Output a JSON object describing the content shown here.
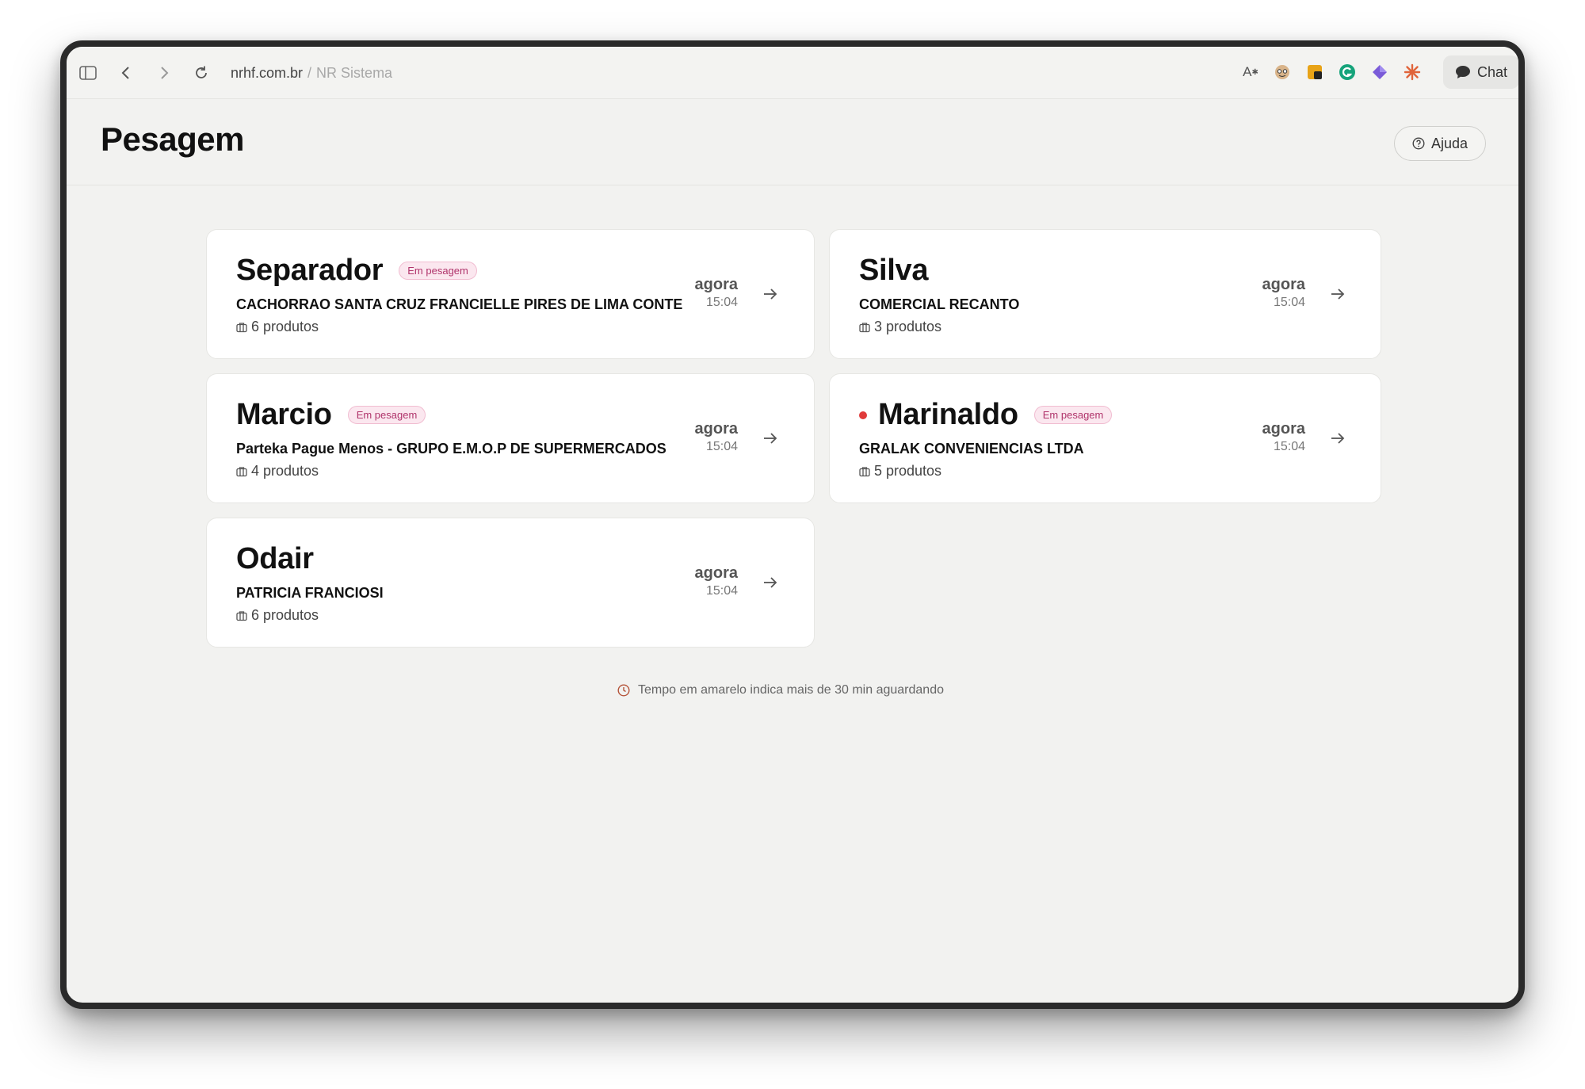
{
  "browser": {
    "url_domain": "nrhf.com.br",
    "url_separator": "/",
    "url_path": "NR Sistema",
    "chat_label": "Chat",
    "extensions": [
      "translate-icon",
      "extension-face-icon",
      "dictionary-icon",
      "grammarly-icon",
      "gem-icon",
      "sparkle-icon"
    ]
  },
  "header": {
    "title": "Pesagem",
    "help_label": "Ajuda"
  },
  "cards": [
    {
      "name": "Separador",
      "badge": "Em pesagem",
      "client": "CACHORRAO SANTA CRUZ FRANCIELLE PIRES DE LIMA CONTE",
      "products": "6 produtos",
      "time_rel": "agora",
      "time_abs": "15:04",
      "alert_dot": false
    },
    {
      "name": "Silva",
      "badge": "",
      "client": "COMERCIAL RECANTO",
      "products": "3 produtos",
      "time_rel": "agora",
      "time_abs": "15:04",
      "alert_dot": false
    },
    {
      "name": "Marcio",
      "badge": "Em pesagem",
      "client": "Parteka Pague Menos - GRUPO E.M.O.P DE SUPERMERCADOS",
      "products": "4 produtos",
      "time_rel": "agora",
      "time_abs": "15:04",
      "alert_dot": false
    },
    {
      "name": "Marinaldo",
      "badge": "Em pesagem",
      "client": "GRALAK CONVENIENCIAS LTDA",
      "products": "5 produtos",
      "time_rel": "agora",
      "time_abs": "15:04",
      "alert_dot": true
    },
    {
      "name": "Odair",
      "badge": "",
      "client": "PATRICIA FRANCIOSI",
      "products": "6 produtos",
      "time_rel": "agora",
      "time_abs": "15:04",
      "alert_dot": false
    }
  ],
  "footnote": "Tempo em amarelo indica mais de 30 min aguardando",
  "colors": {
    "badge_text": "#b0346b",
    "badge_bg": "#fbe7ef",
    "alert_dot": "#e03b3b",
    "clock_icon": "#b5543a"
  }
}
